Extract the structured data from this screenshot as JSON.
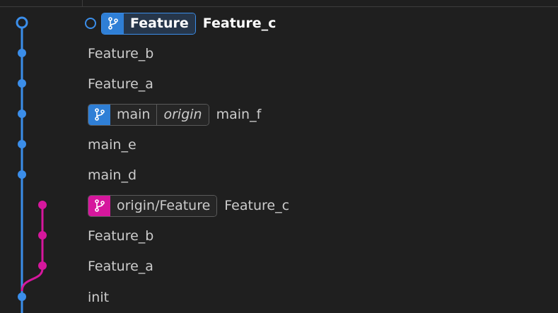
{
  "colors": {
    "main_lane": "#3b8eea",
    "feature_lane": "#d6179d",
    "background": "#1f1f1f",
    "text": "#cccccc"
  },
  "commits": [
    {
      "message": "Feature_c",
      "lane": "main",
      "head": true,
      "refs": [
        {
          "label": "Feature",
          "color": "blue",
          "style": "bold",
          "icon": "branch-icon"
        }
      ]
    },
    {
      "message": "Feature_b",
      "lane": "main"
    },
    {
      "message": "Feature_a",
      "lane": "main"
    },
    {
      "message": "main_f",
      "lane": "main",
      "refs": [
        {
          "label": "main",
          "color": "blue",
          "icon": "branch-icon",
          "remote": "origin"
        }
      ]
    },
    {
      "message": "main_e",
      "lane": "main"
    },
    {
      "message": "main_d",
      "lane": "main"
    },
    {
      "message": "Feature_c",
      "lane": "feature",
      "refs": [
        {
          "label": "origin/Feature",
          "color": "pink",
          "icon": "branch-icon"
        }
      ]
    },
    {
      "message": "Feature_b",
      "lane": "feature"
    },
    {
      "message": "Feature_a",
      "lane": "feature"
    },
    {
      "message": "init",
      "lane": "main"
    }
  ]
}
